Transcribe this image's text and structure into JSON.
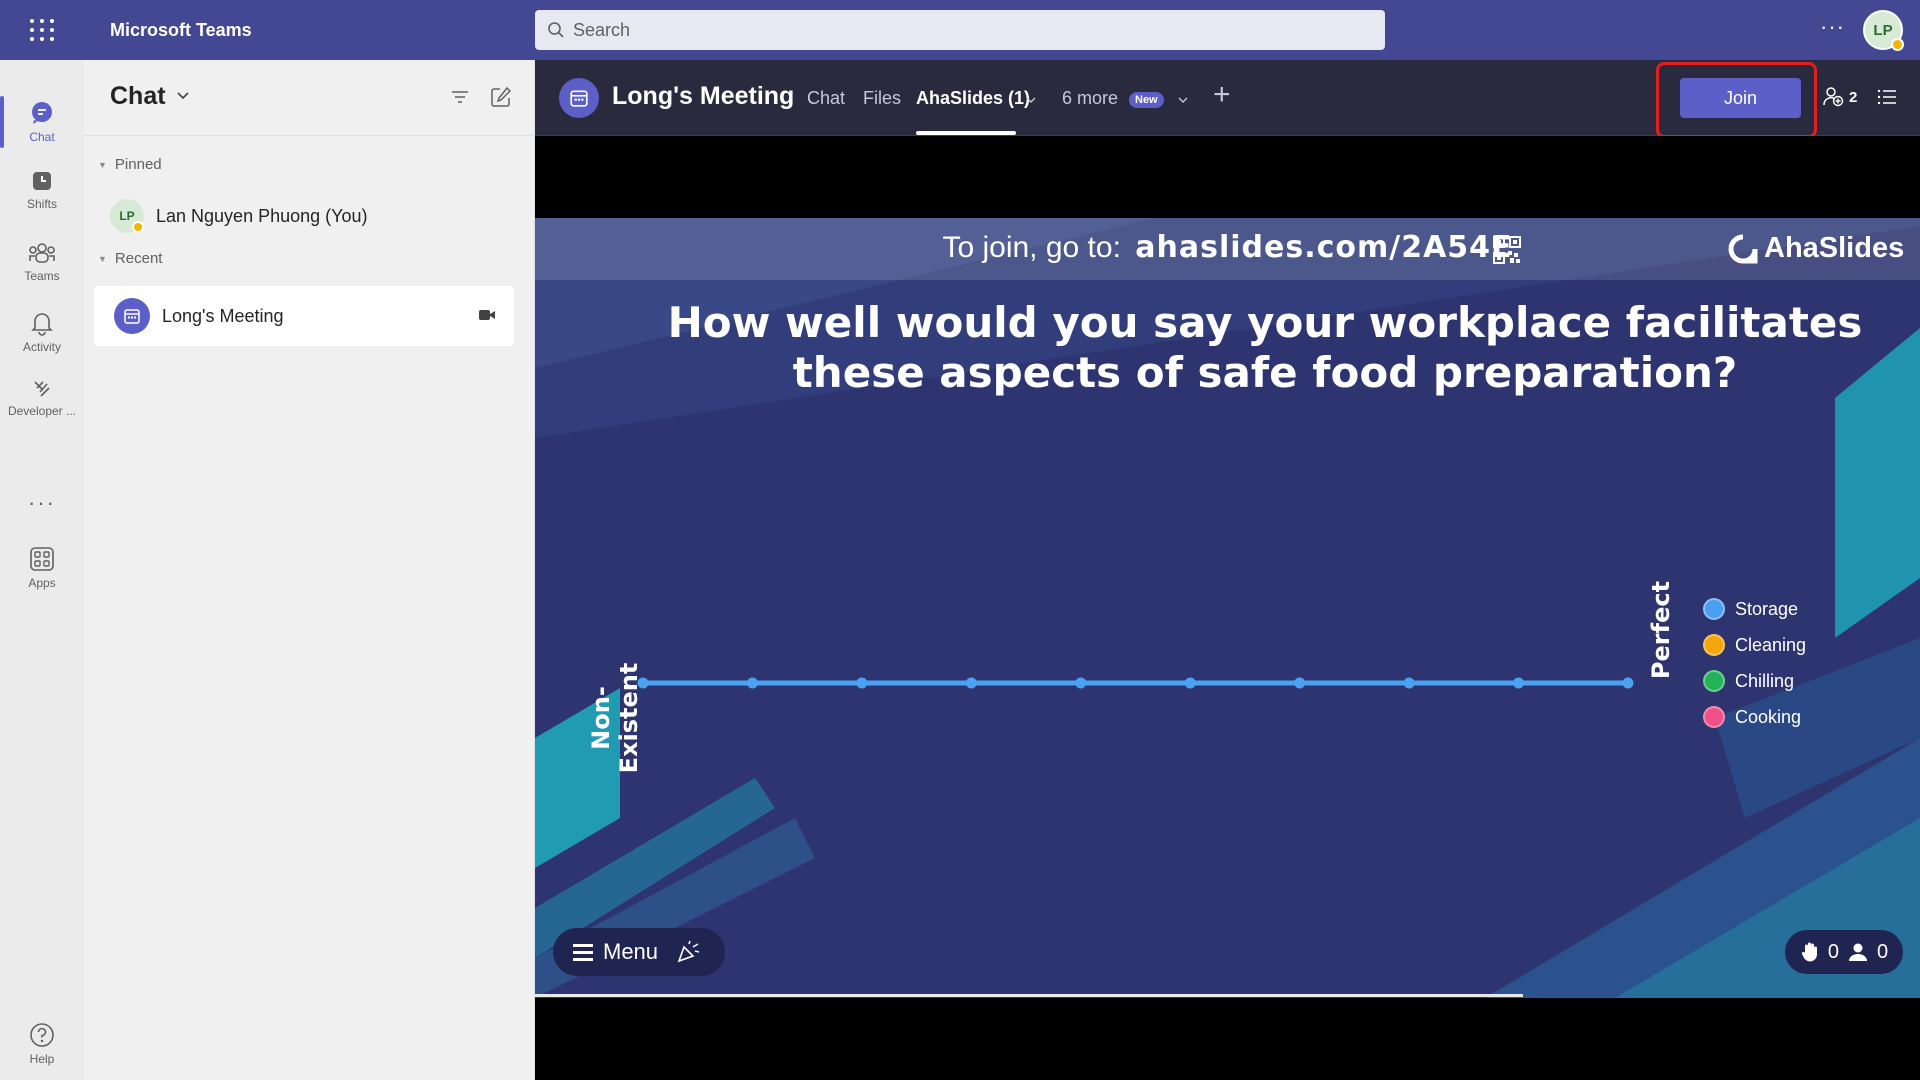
{
  "app": {
    "title": "Microsoft Teams",
    "avatar_initials": "LP"
  },
  "search": {
    "placeholder": "Search"
  },
  "rail": {
    "items": [
      {
        "label": "Chat",
        "icon": "chat-icon",
        "active": true
      },
      {
        "label": "Shifts",
        "icon": "shifts-icon"
      },
      {
        "label": "Teams",
        "icon": "teams-icon"
      },
      {
        "label": "Activity",
        "icon": "bell-icon"
      },
      {
        "label": "Developer ...",
        "icon": "developer-icon"
      },
      {
        "label": "Apps",
        "icon": "apps-icon"
      },
      {
        "label": "Help",
        "icon": "help-icon"
      }
    ]
  },
  "chat_panel": {
    "title": "Chat",
    "pinned_label": "Pinned",
    "recent_label": "Recent",
    "pinned": [
      {
        "initials": "LP",
        "name": "Lan Nguyen Phuong (You)"
      }
    ],
    "recent": [
      {
        "name": "Long's Meeting"
      }
    ]
  },
  "meeting": {
    "title": "Long's Meeting",
    "tabs": [
      {
        "label": "Chat"
      },
      {
        "label": "Files"
      },
      {
        "label": "AhaSlides (1)",
        "active": true
      },
      {
        "label": "6 more"
      }
    ],
    "new_badge": "New",
    "join_label": "Join",
    "participant_count": "2"
  },
  "slide": {
    "join_prefix": "To join, go to:",
    "join_url": "ahaslides.com/2A54E",
    "brand": "AhaSlides",
    "question": "How well would you say your workplace facilitates these aspects of safe food preparation?",
    "scale_min_label": "Non-Existent",
    "scale_max_label": "Perfect",
    "legend": [
      {
        "label": "Storage",
        "color": "#4a9ff0"
      },
      {
        "label": "Cleaning",
        "color": "#f5a70a"
      },
      {
        "label": "Chilling",
        "color": "#25b35a"
      },
      {
        "label": "Cooking",
        "color": "#f0508a"
      }
    ],
    "menu_label": "Menu",
    "hands_count": "0",
    "audience_count": "0",
    "accent_color": "#4aa3f0"
  }
}
